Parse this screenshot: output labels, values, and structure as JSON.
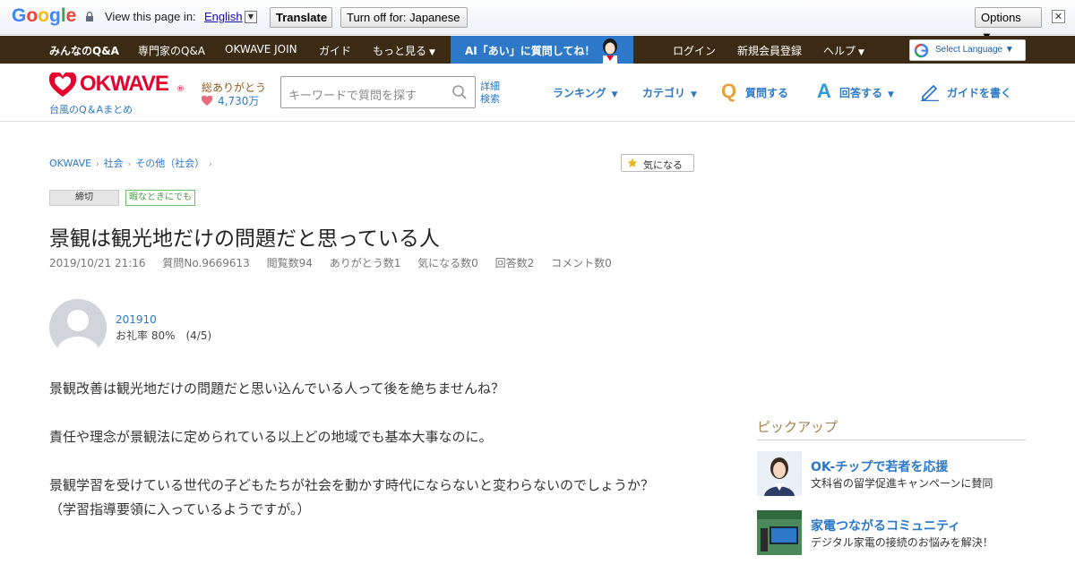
{
  "translate_bar": {
    "logo": "Google",
    "view_text": "View this page in:",
    "language": "English",
    "translate_button": "Translate",
    "turn_off_button": "Turn off for: Japanese",
    "options_button": "Options ▼",
    "close_symbol": "✕"
  },
  "navbar": {
    "items": [
      "みんなのQ&A",
      "専門家のQ&A",
      "OKWAVE JOIN",
      "ガイド",
      "もっと見る"
    ],
    "ai_banner": "AI「あい」に質問してね！",
    "right_items": [
      "ログイン",
      "新規会員登録",
      "ヘルプ"
    ],
    "select_language": "Select Language ▼"
  },
  "header": {
    "logo_text": "OKWAVE",
    "logo_reg": "®",
    "logo_sub": "台風のQ＆Aまとめ",
    "thanks_label": "総ありがとう",
    "thanks_count": "4,730万",
    "search_placeholder": "キーワードで質問を探す",
    "advanced_search": "詳細検索",
    "nav": {
      "ranking": "ランキング",
      "category": "カテゴリ",
      "ask": "質問する",
      "answer": "回答する",
      "write_guide": "ガイドを書く"
    },
    "icon_q": "Q",
    "icon_a": "A"
  },
  "breadcrumb": [
    "OKWAVE",
    "社会",
    "その他（社会）"
  ],
  "watch_button": "気になる",
  "tags": {
    "closed": "締切",
    "leisure": "暇なときにでも"
  },
  "question": {
    "title": "景観は観光地だけの問題だと思っている人",
    "meta": {
      "datetime": "2019/10/21 21:16",
      "question_no": "質問No.9669613",
      "views": "閲覧数94",
      "thanks": "ありがとう数1",
      "watch": "気になる数0",
      "answers": "回答数2",
      "comments": "コメント数0"
    },
    "user": {
      "name": "201910",
      "rate": "お礼率 80%　(4/5)"
    },
    "body": [
      "景観改善は観光地だけの問題だと思い込んでいる人って後を絶ちませんね？",
      "責任や理念が景観法に定められている以上どの地域でも基本大事なのに。",
      "景観学習を受けている世代の子どもたちが社会を動かす時代にならないと変わらないのでしょうか？",
      "（学習指導要領に入っているようですが。）"
    ]
  },
  "pickup": {
    "title": "ピックアップ",
    "items": [
      {
        "title": "OK-チップで若者を応援",
        "desc": "文科省の留学促進キャンペーンに賛同"
      },
      {
        "title": "家電つながるコミュニティ",
        "desc": "デジタル家電の接続のお悩みを解決！"
      }
    ]
  },
  "colors": {
    "brand_red": "#e5002d",
    "link_blue": "#2d78c8",
    "nav_dark": "#3b2a14",
    "ai_blue": "#2d78c8"
  }
}
